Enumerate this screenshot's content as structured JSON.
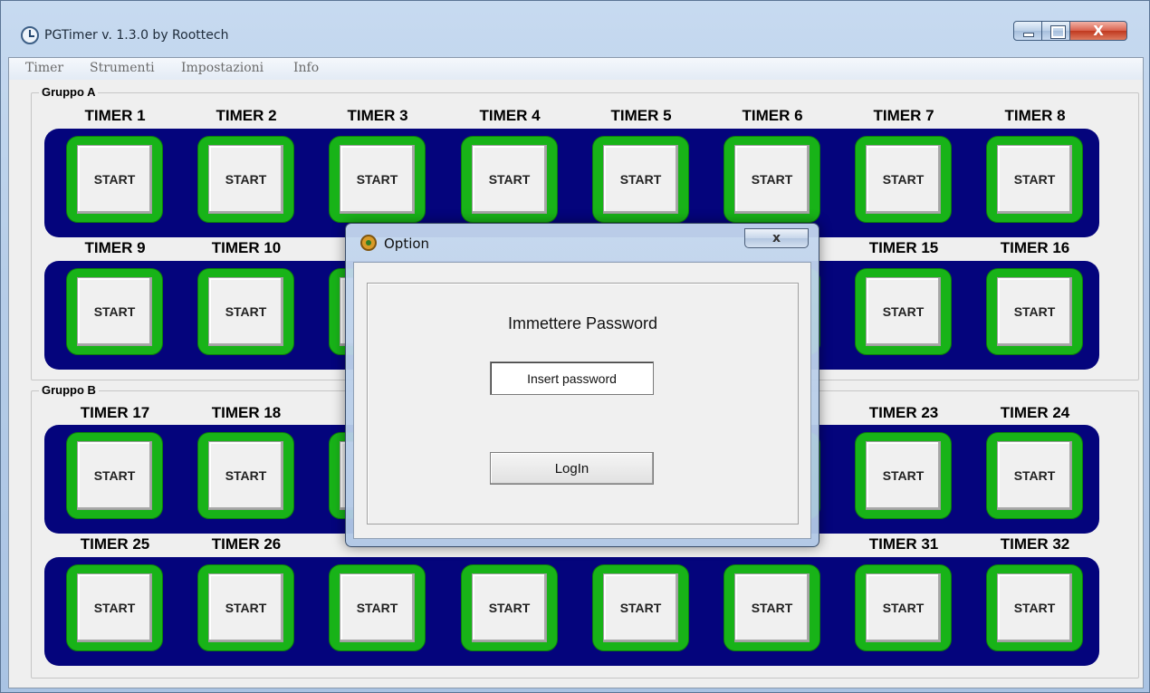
{
  "window": {
    "title": "PGTimer  v. 1.3.0  by Roottech",
    "close_glyph": "X",
    "icon": "clock-icon"
  },
  "menu": [
    {
      "label": "Timer"
    },
    {
      "label": "Strumenti"
    },
    {
      "label": "Impostazioni"
    },
    {
      "label": "Info"
    }
  ],
  "groups": [
    {
      "label": "Gruppo A"
    },
    {
      "label": "Gruppo B"
    }
  ],
  "timers": [
    {
      "label": "TIMER  1",
      "button": "START"
    },
    {
      "label": "TIMER  2",
      "button": "START"
    },
    {
      "label": "TIMER  3",
      "button": "START"
    },
    {
      "label": "TIMER  4",
      "button": "START"
    },
    {
      "label": "TIMER  5",
      "button": "START"
    },
    {
      "label": "TIMER  6",
      "button": "START"
    },
    {
      "label": "TIMER  7",
      "button": "START"
    },
    {
      "label": "TIMER  8",
      "button": "START"
    },
    {
      "label": "TIMER  9",
      "button": "START"
    },
    {
      "label": "TIMER 10",
      "button": "START"
    },
    {
      "label": "",
      "button": ""
    },
    {
      "label": "",
      "button": ""
    },
    {
      "label": "",
      "button": ""
    },
    {
      "label": "",
      "button": ""
    },
    {
      "label": "TIMER 15",
      "button": "START"
    },
    {
      "label": "TIMER 16",
      "button": "START"
    },
    {
      "label": "TIMER 17",
      "button": "START"
    },
    {
      "label": "TIMER 18",
      "button": "START"
    },
    {
      "label": "",
      "button": ""
    },
    {
      "label": "",
      "button": ""
    },
    {
      "label": "",
      "button": ""
    },
    {
      "label": "",
      "button": ""
    },
    {
      "label": "TIMER 23",
      "button": "START"
    },
    {
      "label": "TIMER 24",
      "button": "START"
    },
    {
      "label": "TIMER 25",
      "button": "START"
    },
    {
      "label": "TIMER 26",
      "button": "START"
    },
    {
      "label": "",
      "button": "START"
    },
    {
      "label": "",
      "button": "START"
    },
    {
      "label": "",
      "button": "START"
    },
    {
      "label": "",
      "button": "START"
    },
    {
      "label": "TIMER 31",
      "button": "START"
    },
    {
      "label": "TIMER 32",
      "button": "START"
    }
  ],
  "colors": {
    "panel": "#04047c",
    "tile": "#18b318"
  },
  "dialog": {
    "title": "Option",
    "close_glyph": "x",
    "prompt": "Immettere Password",
    "password_placeholder": "Insert password",
    "password_value": "",
    "login_label": "LogIn"
  }
}
